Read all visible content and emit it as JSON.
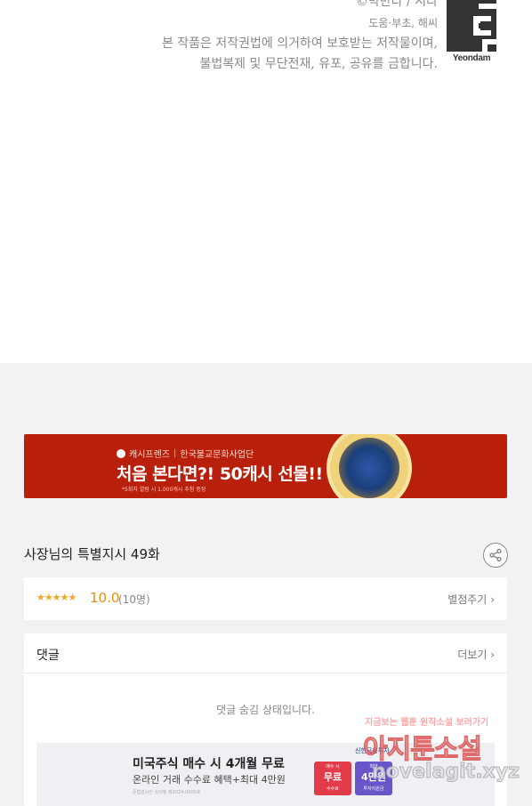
{
  "credits": {
    "authors": "©박만다 / 시다",
    "helpers": "도움·부초, 해씨",
    "notice_line1": "본 작품은 저작권법에 의거하여 보호받는 저작물이며,",
    "notice_line2": "불법복제 및 무단전재, 유포, 공유를 금합니다.",
    "publisher": "Yeondam"
  },
  "ad_banner": {
    "brand": "캐시프렌즈",
    "partner": "한국불교문화사업단",
    "headline": "처음 본다면?! 50캐시 선물!!",
    "fine_print": "*5회차 열람 시 1,000캐시 추첨 증정"
  },
  "episode": {
    "title": "사장님의 특별지시 49화",
    "share_icon": "share-icon"
  },
  "rating": {
    "stars": "★★★★★",
    "score": "10.0",
    "count": "(10명)",
    "rate_link": "별점주기",
    "chevron": "›"
  },
  "comments": {
    "title": "댓글",
    "more": "더보기",
    "chevron": "›",
    "hidden_message": "댓글 숨김 상태입니다."
  },
  "stock_ad": {
    "headline": "미국주식 매수 시 4개월 무료",
    "subline": "온라인 거래 수수료 혜택+최대 4만원",
    "fine_print": "준법감시인 심의필 제2024-0000호",
    "bank": "신한금융투자",
    "card1_small": "매수 시",
    "card1_big": "무료",
    "card1_foot": "수수료",
    "card2_small": "최대",
    "card2_big": "4만원",
    "card2_foot": "투자지원금"
  },
  "watermark": {
    "top": "지금보는 웹툰 원작소설 보러가기",
    "mid": "아지툰소설",
    "bot": "novelagit.xyz"
  }
}
